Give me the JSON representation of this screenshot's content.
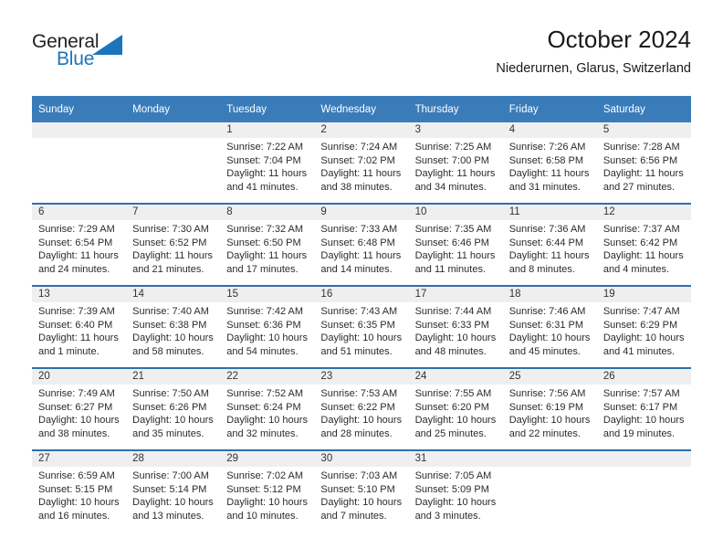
{
  "logo": {
    "word_one": "General",
    "word_two": "Blue",
    "triangle_color": "#1b75bb",
    "text_color": "#231f20"
  },
  "header": {
    "title": "October 2024",
    "location": "Niederurnen, Glarus, Switzerland"
  },
  "theme": {
    "header_blue": "#3a7cba",
    "row_divider_blue": "#2f6fae",
    "daynum_band": "#efefef"
  },
  "weekday_headers": [
    "Sunday",
    "Monday",
    "Tuesday",
    "Wednesday",
    "Thursday",
    "Friday",
    "Saturday"
  ],
  "labels": {
    "sunrise_prefix": "Sunrise:",
    "sunset_prefix": "Sunset:",
    "daylight_prefix": "Daylight:"
  },
  "weeks": [
    [
      {
        "day": "",
        "empty": true
      },
      {
        "day": "",
        "empty": true
      },
      {
        "day": "1",
        "sunrise": "Sunrise: 7:22 AM",
        "sunset": "Sunset: 7:04 PM",
        "daylight_line1": "Daylight: 11 hours",
        "daylight_line2": "and 41 minutes."
      },
      {
        "day": "2",
        "sunrise": "Sunrise: 7:24 AM",
        "sunset": "Sunset: 7:02 PM",
        "daylight_line1": "Daylight: 11 hours",
        "daylight_line2": "and 38 minutes."
      },
      {
        "day": "3",
        "sunrise": "Sunrise: 7:25 AM",
        "sunset": "Sunset: 7:00 PM",
        "daylight_line1": "Daylight: 11 hours",
        "daylight_line2": "and 34 minutes."
      },
      {
        "day": "4",
        "sunrise": "Sunrise: 7:26 AM",
        "sunset": "Sunset: 6:58 PM",
        "daylight_line1": "Daylight: 11 hours",
        "daylight_line2": "and 31 minutes."
      },
      {
        "day": "5",
        "sunrise": "Sunrise: 7:28 AM",
        "sunset": "Sunset: 6:56 PM",
        "daylight_line1": "Daylight: 11 hours",
        "daylight_line2": "and 27 minutes."
      }
    ],
    [
      {
        "day": "6",
        "sunrise": "Sunrise: 7:29 AM",
        "sunset": "Sunset: 6:54 PM",
        "daylight_line1": "Daylight: 11 hours",
        "daylight_line2": "and 24 minutes."
      },
      {
        "day": "7",
        "sunrise": "Sunrise: 7:30 AM",
        "sunset": "Sunset: 6:52 PM",
        "daylight_line1": "Daylight: 11 hours",
        "daylight_line2": "and 21 minutes."
      },
      {
        "day": "8",
        "sunrise": "Sunrise: 7:32 AM",
        "sunset": "Sunset: 6:50 PM",
        "daylight_line1": "Daylight: 11 hours",
        "daylight_line2": "and 17 minutes."
      },
      {
        "day": "9",
        "sunrise": "Sunrise: 7:33 AM",
        "sunset": "Sunset: 6:48 PM",
        "daylight_line1": "Daylight: 11 hours",
        "daylight_line2": "and 14 minutes."
      },
      {
        "day": "10",
        "sunrise": "Sunrise: 7:35 AM",
        "sunset": "Sunset: 6:46 PM",
        "daylight_line1": "Daylight: 11 hours",
        "daylight_line2": "and 11 minutes."
      },
      {
        "day": "11",
        "sunrise": "Sunrise: 7:36 AM",
        "sunset": "Sunset: 6:44 PM",
        "daylight_line1": "Daylight: 11 hours",
        "daylight_line2": "and 8 minutes."
      },
      {
        "day": "12",
        "sunrise": "Sunrise: 7:37 AM",
        "sunset": "Sunset: 6:42 PM",
        "daylight_line1": "Daylight: 11 hours",
        "daylight_line2": "and 4 minutes."
      }
    ],
    [
      {
        "day": "13",
        "sunrise": "Sunrise: 7:39 AM",
        "sunset": "Sunset: 6:40 PM",
        "daylight_line1": "Daylight: 11 hours",
        "daylight_line2": "and 1 minute."
      },
      {
        "day": "14",
        "sunrise": "Sunrise: 7:40 AM",
        "sunset": "Sunset: 6:38 PM",
        "daylight_line1": "Daylight: 10 hours",
        "daylight_line2": "and 58 minutes."
      },
      {
        "day": "15",
        "sunrise": "Sunrise: 7:42 AM",
        "sunset": "Sunset: 6:36 PM",
        "daylight_line1": "Daylight: 10 hours",
        "daylight_line2": "and 54 minutes."
      },
      {
        "day": "16",
        "sunrise": "Sunrise: 7:43 AM",
        "sunset": "Sunset: 6:35 PM",
        "daylight_line1": "Daylight: 10 hours",
        "daylight_line2": "and 51 minutes."
      },
      {
        "day": "17",
        "sunrise": "Sunrise: 7:44 AM",
        "sunset": "Sunset: 6:33 PM",
        "daylight_line1": "Daylight: 10 hours",
        "daylight_line2": "and 48 minutes."
      },
      {
        "day": "18",
        "sunrise": "Sunrise: 7:46 AM",
        "sunset": "Sunset: 6:31 PM",
        "daylight_line1": "Daylight: 10 hours",
        "daylight_line2": "and 45 minutes."
      },
      {
        "day": "19",
        "sunrise": "Sunrise: 7:47 AM",
        "sunset": "Sunset: 6:29 PM",
        "daylight_line1": "Daylight: 10 hours",
        "daylight_line2": "and 41 minutes."
      }
    ],
    [
      {
        "day": "20",
        "sunrise": "Sunrise: 7:49 AM",
        "sunset": "Sunset: 6:27 PM",
        "daylight_line1": "Daylight: 10 hours",
        "daylight_line2": "and 38 minutes."
      },
      {
        "day": "21",
        "sunrise": "Sunrise: 7:50 AM",
        "sunset": "Sunset: 6:26 PM",
        "daylight_line1": "Daylight: 10 hours",
        "daylight_line2": "and 35 minutes."
      },
      {
        "day": "22",
        "sunrise": "Sunrise: 7:52 AM",
        "sunset": "Sunset: 6:24 PM",
        "daylight_line1": "Daylight: 10 hours",
        "daylight_line2": "and 32 minutes."
      },
      {
        "day": "23",
        "sunrise": "Sunrise: 7:53 AM",
        "sunset": "Sunset: 6:22 PM",
        "daylight_line1": "Daylight: 10 hours",
        "daylight_line2": "and 28 minutes."
      },
      {
        "day": "24",
        "sunrise": "Sunrise: 7:55 AM",
        "sunset": "Sunset: 6:20 PM",
        "daylight_line1": "Daylight: 10 hours",
        "daylight_line2": "and 25 minutes."
      },
      {
        "day": "25",
        "sunrise": "Sunrise: 7:56 AM",
        "sunset": "Sunset: 6:19 PM",
        "daylight_line1": "Daylight: 10 hours",
        "daylight_line2": "and 22 minutes."
      },
      {
        "day": "26",
        "sunrise": "Sunrise: 7:57 AM",
        "sunset": "Sunset: 6:17 PM",
        "daylight_line1": "Daylight: 10 hours",
        "daylight_line2": "and 19 minutes."
      }
    ],
    [
      {
        "day": "27",
        "sunrise": "Sunrise: 6:59 AM",
        "sunset": "Sunset: 5:15 PM",
        "daylight_line1": "Daylight: 10 hours",
        "daylight_line2": "and 16 minutes."
      },
      {
        "day": "28",
        "sunrise": "Sunrise: 7:00 AM",
        "sunset": "Sunset: 5:14 PM",
        "daylight_line1": "Daylight: 10 hours",
        "daylight_line2": "and 13 minutes."
      },
      {
        "day": "29",
        "sunrise": "Sunrise: 7:02 AM",
        "sunset": "Sunset: 5:12 PM",
        "daylight_line1": "Daylight: 10 hours",
        "daylight_line2": "and 10 minutes."
      },
      {
        "day": "30",
        "sunrise": "Sunrise: 7:03 AM",
        "sunset": "Sunset: 5:10 PM",
        "daylight_line1": "Daylight: 10 hours",
        "daylight_line2": "and 7 minutes."
      },
      {
        "day": "31",
        "sunrise": "Sunrise: 7:05 AM",
        "sunset": "Sunset: 5:09 PM",
        "daylight_line1": "Daylight: 10 hours",
        "daylight_line2": "and 3 minutes."
      },
      {
        "day": "",
        "empty": true
      },
      {
        "day": "",
        "empty": true
      }
    ]
  ]
}
